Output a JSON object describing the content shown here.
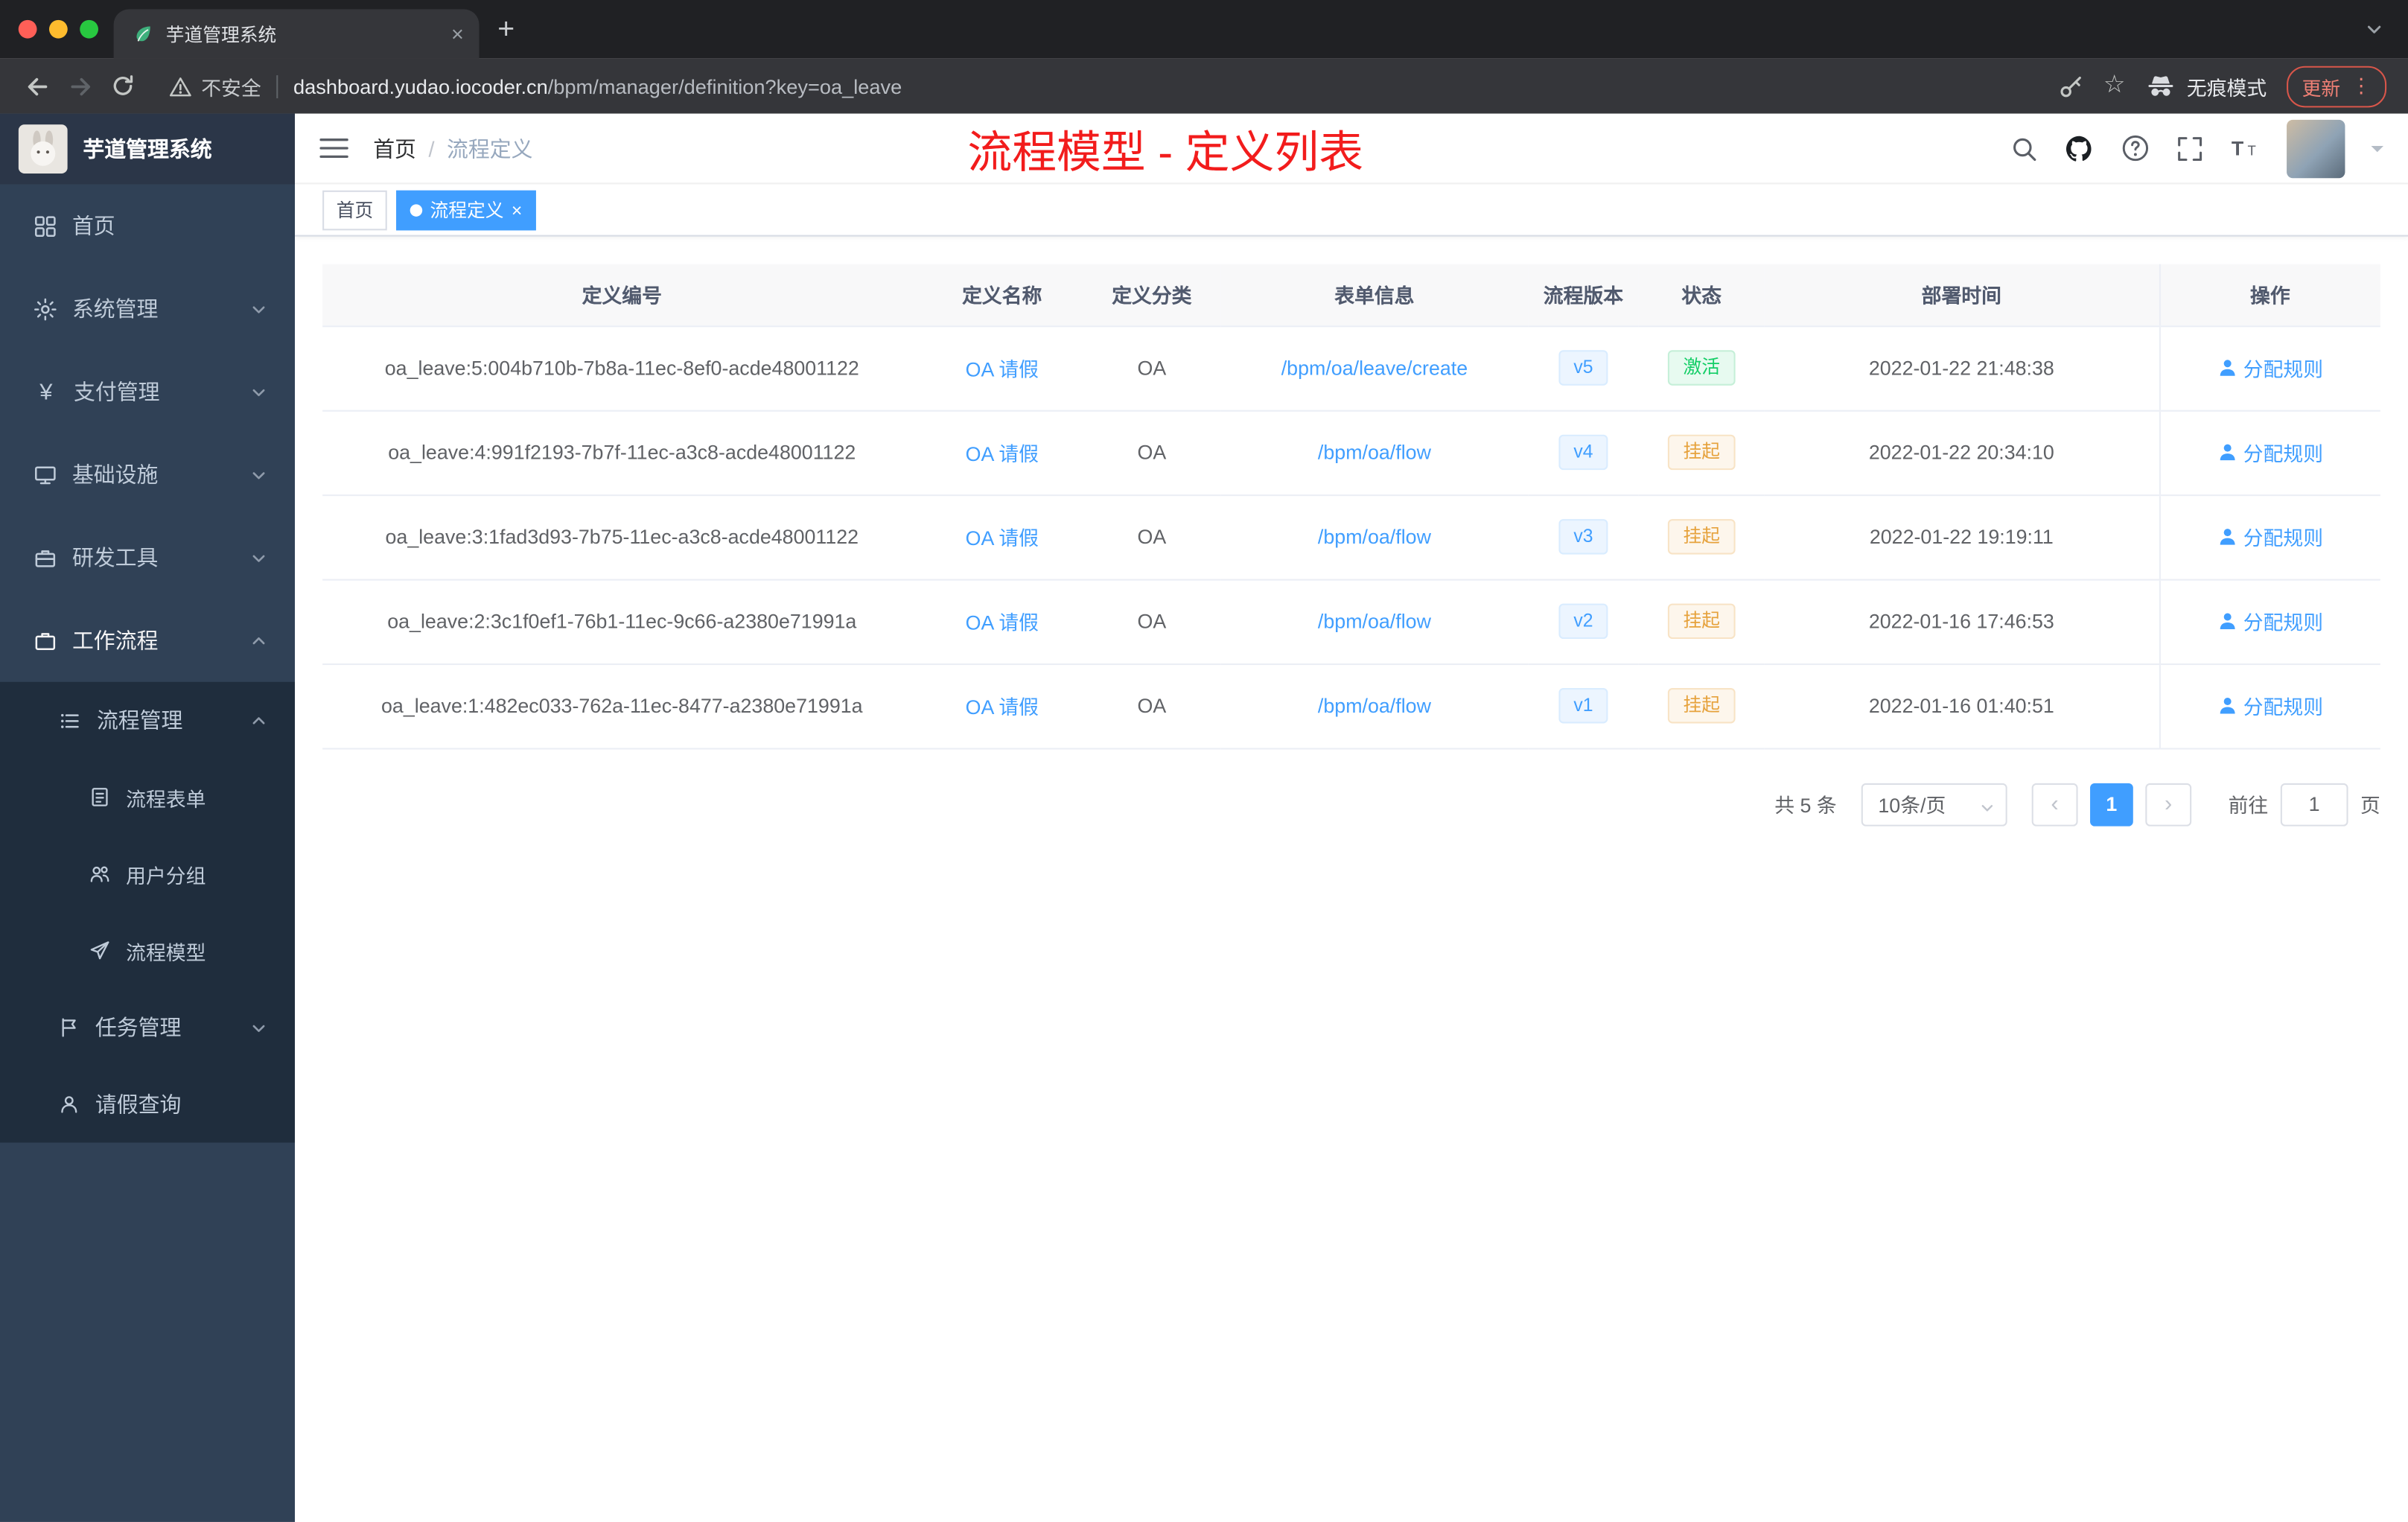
{
  "browser": {
    "tab_title": "芋道管理系统",
    "security_label": "不安全",
    "url_host": "dashboard.yudao.iocoder.cn",
    "url_path": "/bpm/manager/definition?key=oa_leave",
    "incognito_label": "无痕模式",
    "update_label": "更新"
  },
  "icons": {
    "close": "×",
    "plus": "+",
    "more": "⋮",
    "star": "☆",
    "prev": "‹",
    "next": "›",
    "yen": "¥"
  },
  "palette": {
    "accent_blue": "#409eff",
    "success_green": "#13ce66",
    "warning_orange": "#e6a23c",
    "annotation_red": "#f21c1c",
    "sidebar_bg": "#304156",
    "submenu_bg": "#1f2d3d"
  },
  "sidebar": {
    "logo_title": "芋道管理系统",
    "items": [
      {
        "label": "首页"
      },
      {
        "label": "系统管理"
      },
      {
        "label": "支付管理"
      },
      {
        "label": "基础设施"
      },
      {
        "label": "研发工具"
      },
      {
        "label": "工作流程"
      }
    ],
    "submenu": [
      {
        "label": "流程管理"
      },
      {
        "label": "流程表单"
      },
      {
        "label": "用户分组"
      },
      {
        "label": "流程模型"
      },
      {
        "label": "任务管理"
      },
      {
        "label": "请假查询"
      }
    ]
  },
  "navbar": {
    "breadcrumb_home": "首页",
    "breadcrumb_sep": "/",
    "breadcrumb_current": "流程定义",
    "annotation_title": "流程模型 - 定义列表"
  },
  "tags": {
    "home": "首页",
    "current": "流程定义"
  },
  "table": {
    "columns": [
      "定义编号",
      "定义名称",
      "定义分类",
      "表单信息",
      "流程版本",
      "状态",
      "部署时间",
      "操作"
    ],
    "rows": [
      {
        "id": "oa_leave:5:004b710b-7b8a-11ec-8ef0-acde48001122",
        "name": "OA 请假",
        "category": "OA",
        "form": "/bpm/oa/leave/create",
        "version": "v5",
        "status": "激活",
        "deploy_time": "2022-01-22 21:48:38",
        "action": "分配规则"
      },
      {
        "id": "oa_leave:4:991f2193-7b7f-11ec-a3c8-acde48001122",
        "name": "OA 请假",
        "category": "OA",
        "form": "/bpm/oa/flow",
        "version": "v4",
        "status": "挂起",
        "deploy_time": "2022-01-22 20:34:10",
        "action": "分配规则"
      },
      {
        "id": "oa_leave:3:1fad3d93-7b75-11ec-a3c8-acde48001122",
        "name": "OA 请假",
        "category": "OA",
        "form": "/bpm/oa/flow",
        "version": "v3",
        "status": "挂起",
        "deploy_time": "2022-01-22 19:19:11",
        "action": "分配规则"
      },
      {
        "id": "oa_leave:2:3c1f0ef1-76b1-11ec-9c66-a2380e71991a",
        "name": "OA 请假",
        "category": "OA",
        "form": "/bpm/oa/flow",
        "version": "v2",
        "status": "挂起",
        "deploy_time": "2022-01-16 17:46:53",
        "action": "分配规则"
      },
      {
        "id": "oa_leave:1:482ec033-762a-11ec-8477-a2380e71991a",
        "name": "OA 请假",
        "category": "OA",
        "form": "/bpm/oa/flow",
        "version": "v1",
        "status": "挂起",
        "deploy_time": "2022-01-16 01:40:51",
        "action": "分配规则"
      }
    ]
  },
  "pagination": {
    "total": "共 5 条",
    "page_size": "10条/页",
    "current_page": "1",
    "goto_label": "前往",
    "goto_value": "1",
    "page_unit": "页"
  }
}
